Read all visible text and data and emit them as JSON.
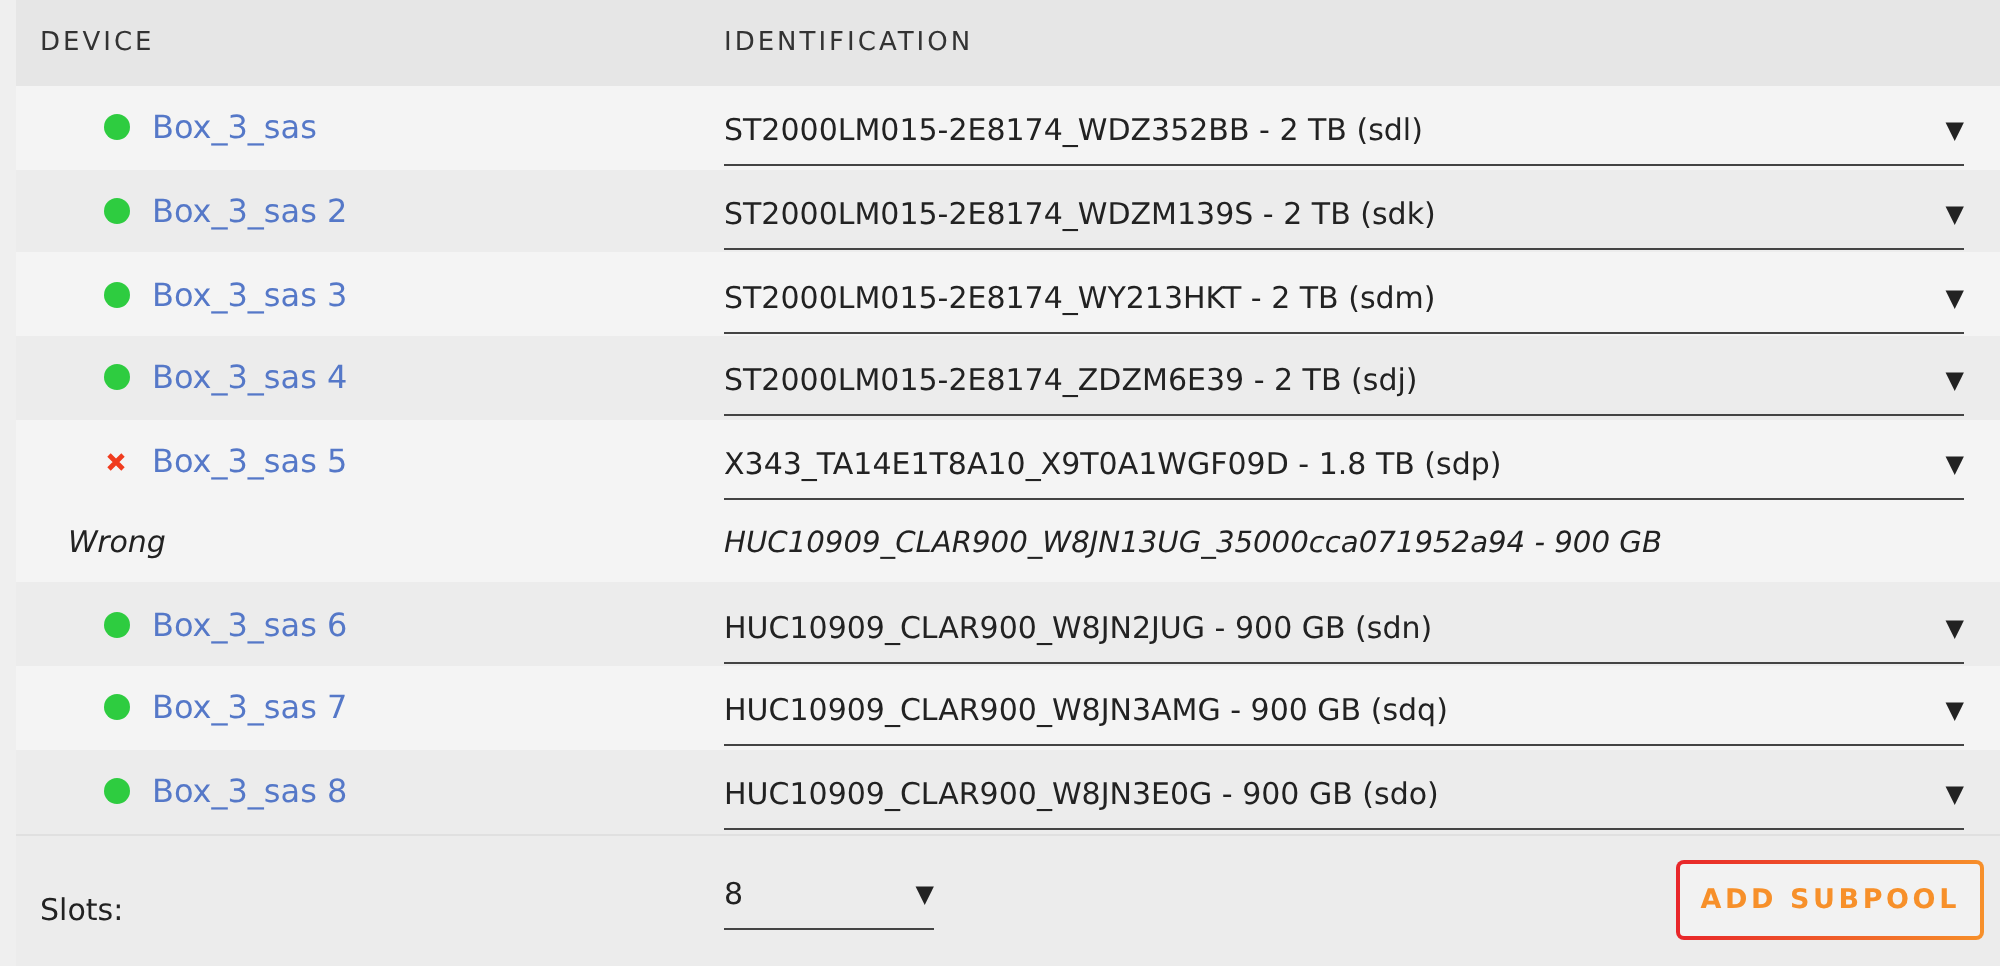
{
  "table": {
    "columns": [
      "DEVICE",
      "IDENTIFICATION"
    ],
    "rows": [
      {
        "kind": "ok",
        "device": "Box_3_sas",
        "identification": "ST2000LM015-2E8174_WDZ352BB - 2 TB (sdl)",
        "caret": "▼"
      },
      {
        "kind": "ok",
        "device": "Box_3_sas 2",
        "identification": "ST2000LM015-2E8174_WDZM139S - 2 TB (sdk)",
        "caret": "▼"
      },
      {
        "kind": "ok",
        "device": "Box_3_sas 3",
        "identification": "ST2000LM015-2E8174_WY213HKT - 2 TB (sdm)",
        "caret": "▼"
      },
      {
        "kind": "ok",
        "device": "Box_3_sas 4",
        "identification": "ST2000LM015-2E8174_ZDZM6E39 - 2 TB (sdj)",
        "caret": "▼"
      },
      {
        "kind": "error",
        "device": "Box_3_sas 5",
        "identification": "X343_TA14E1T8A10_X9T0A1WGF09D - 1.8 TB (sdp)",
        "caret": "▼",
        "wrong_label": "Wrong",
        "wrong_identification": "HUC10909_CLAR900_W8JN13UG_35000cca071952a94 - 900 GB"
      },
      {
        "kind": "ok",
        "device": "Box_3_sas 6",
        "identification": "HUC10909_CLAR900_W8JN2JUG - 900 GB (sdn)",
        "caret": "▼"
      },
      {
        "kind": "ok",
        "device": "Box_3_sas 7",
        "identification": "HUC10909_CLAR900_W8JN3AMG - 900 GB (sdq)",
        "caret": "▼"
      },
      {
        "kind": "ok",
        "device": "Box_3_sas 8",
        "identification": "HUC10909_CLAR900_W8JN3E0G - 900 GB (sdo)",
        "caret": "▼"
      }
    ]
  },
  "footer": {
    "slots_label": "Slots:",
    "slots_value": "8",
    "slots_caret": "▼",
    "button": "ADD SUBPOOL"
  }
}
